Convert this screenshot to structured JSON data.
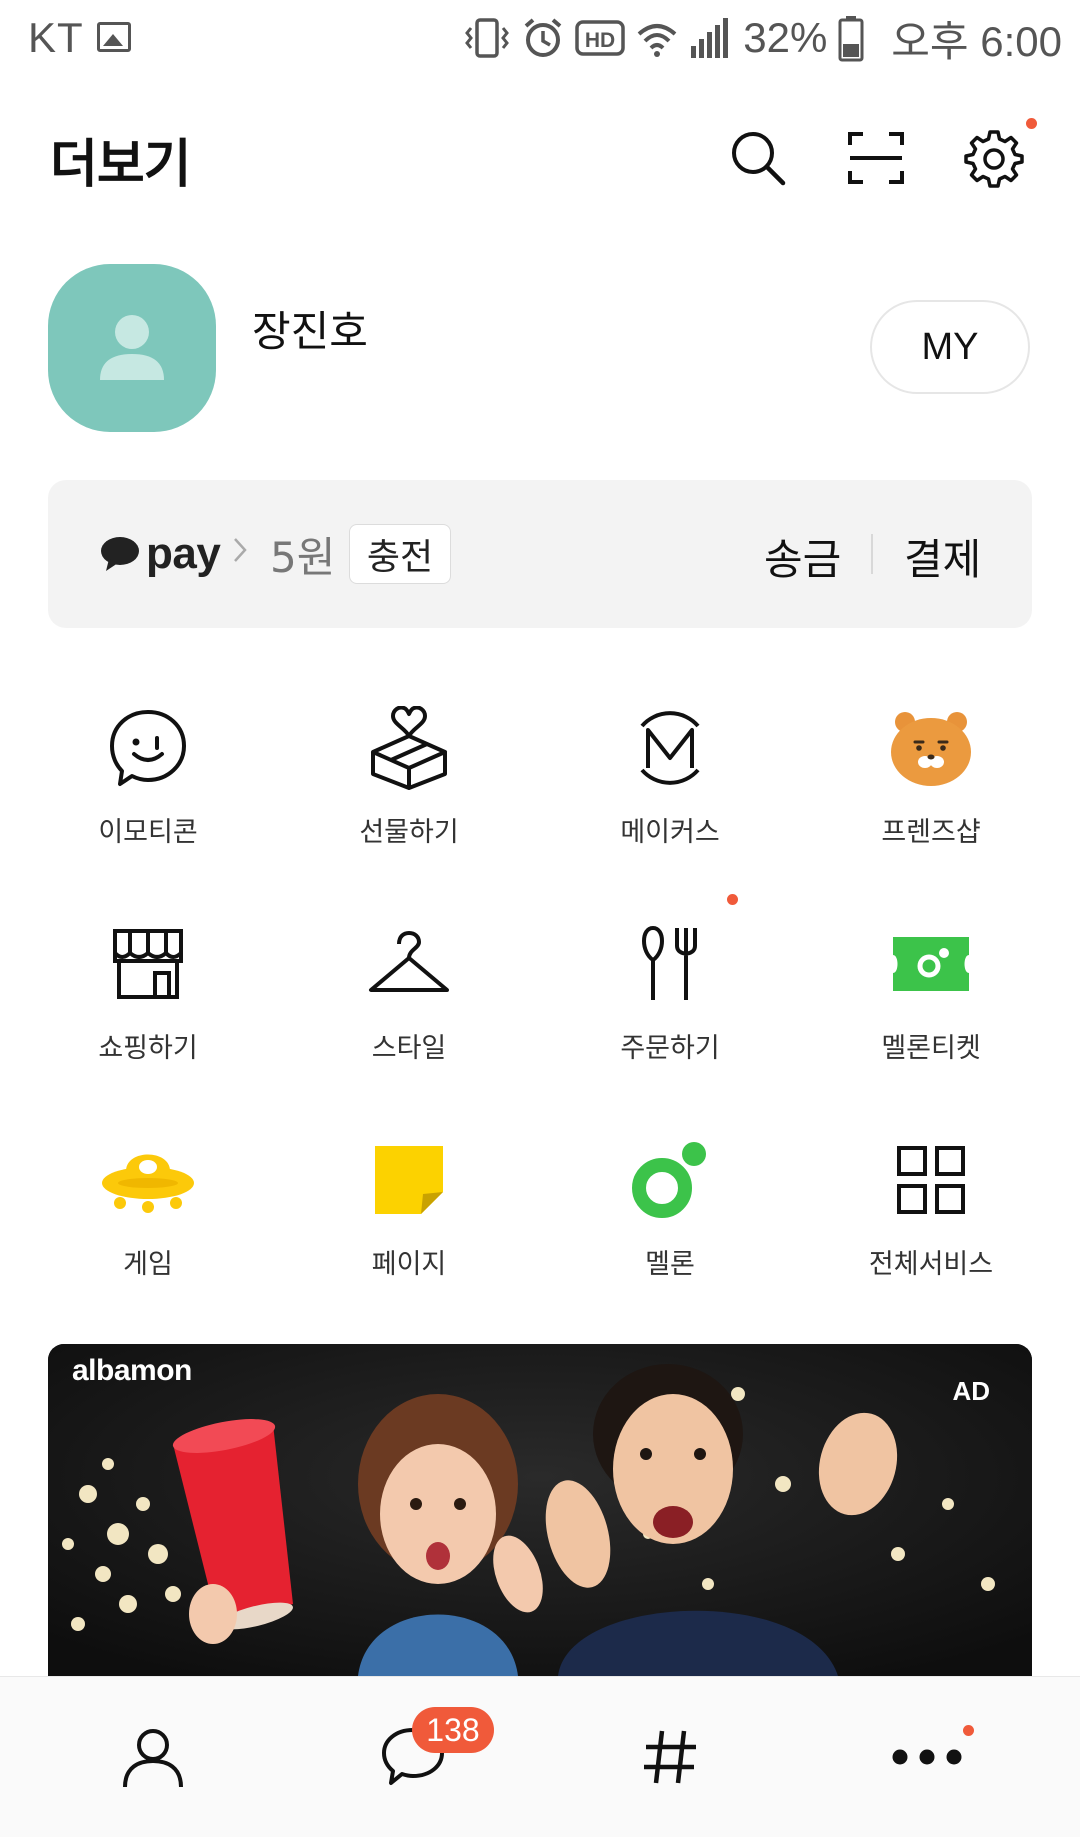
{
  "status_bar": {
    "carrier": "KT",
    "battery_percent": "32%",
    "time": "오후 6:00",
    "hd_label": "HD"
  },
  "header": {
    "title": "더보기"
  },
  "profile": {
    "name": "장진호",
    "my_button_label": "MY"
  },
  "pay": {
    "logo_text": "pay",
    "balance": "5원",
    "charge_label": "충전",
    "send_label": "송금",
    "payment_label": "결제"
  },
  "services": [
    {
      "label": "이모티콘"
    },
    {
      "label": "선물하기"
    },
    {
      "label": "메이커스"
    },
    {
      "label": "프렌즈샵"
    },
    {
      "label": "쇼핑하기"
    },
    {
      "label": "스타일"
    },
    {
      "label": "주문하기"
    },
    {
      "label": "멜론티켓"
    },
    {
      "label": "게임"
    },
    {
      "label": "페이지"
    },
    {
      "label": "멜론"
    },
    {
      "label": "전체서비스"
    }
  ],
  "ad": {
    "brand": "albamon",
    "badge": "AD"
  },
  "bottom_nav": {
    "chats_badge": "138"
  },
  "colors": {
    "accent_red": "#f05a3a",
    "avatar_teal": "#7ec7bb",
    "melon_green": "#3cc34a",
    "pay_card_bg": "#f3f3f3",
    "game_yellow": "#fcc90a"
  }
}
